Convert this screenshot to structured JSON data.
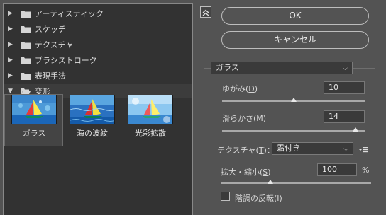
{
  "filter_gallery": {
    "categories": [
      {
        "label": "アーティスティック",
        "expanded": false
      },
      {
        "label": "スケッチ",
        "expanded": false
      },
      {
        "label": "テクスチャ",
        "expanded": false
      },
      {
        "label": "ブラシストローク",
        "expanded": false
      },
      {
        "label": "表現手法",
        "expanded": false
      },
      {
        "label": "変形",
        "expanded": true
      }
    ],
    "thumbnails": [
      {
        "label": "ガラス",
        "selected": true
      },
      {
        "label": "海の波紋",
        "selected": false
      },
      {
        "label": "光彩拡散",
        "selected": false
      }
    ]
  },
  "buttons": {
    "ok": "OK",
    "cancel": "キャンセル"
  },
  "settings": {
    "filter_select": "ガラス",
    "distortion": {
      "label_pre": "ゆがみ(",
      "key": "D",
      "label_post": ")",
      "value": "10",
      "level": 0.5
    },
    "smoothness": {
      "label_pre": "滑らかさ(",
      "key": "M",
      "label_post": ")",
      "value": "14",
      "level": 0.93
    },
    "texture": {
      "label_pre": "テクスチャ(",
      "key": "T",
      "label_post": ")：",
      "selected": "霜付き"
    },
    "scaling": {
      "label_pre": "拡大・縮小(",
      "key": "S",
      "label_post": ")",
      "value": "100",
      "unit": "%",
      "level": 0.33
    },
    "invert": {
      "label_pre": "階調の反転(",
      "key": "I",
      "label_post": ")",
      "checked": false
    }
  },
  "colors": {
    "panel_bg": "#535353",
    "list_bg": "#323232",
    "field_bg": "#3a3a3a"
  }
}
